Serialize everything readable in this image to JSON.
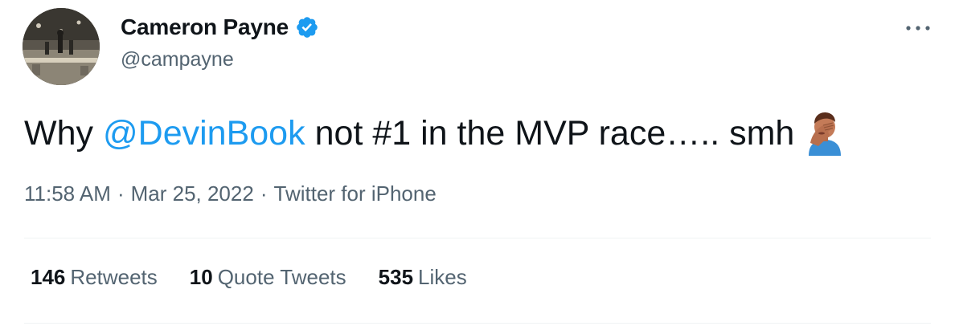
{
  "author": {
    "display_name": "Cameron Payne",
    "handle": "@campayne",
    "verified": true
  },
  "tweet": {
    "text_prefix": "Why",
    "mention": "@DevinBook",
    "text_suffix": "not #1 in the MVP race….. smh",
    "emoji": "facepalm-icon"
  },
  "meta": {
    "time": "11:58 AM",
    "separator": "·",
    "date": "Mar 25, 2022",
    "source": "Twitter for iPhone"
  },
  "stats": [
    {
      "count": "146",
      "label": "Retweets"
    },
    {
      "count": "10",
      "label": "Quote Tweets"
    },
    {
      "count": "535",
      "label": "Likes"
    }
  ],
  "colors": {
    "accent": "#1d9bf0",
    "text": "#0f1419",
    "secondary": "#536471",
    "divider": "#eff3f4"
  }
}
